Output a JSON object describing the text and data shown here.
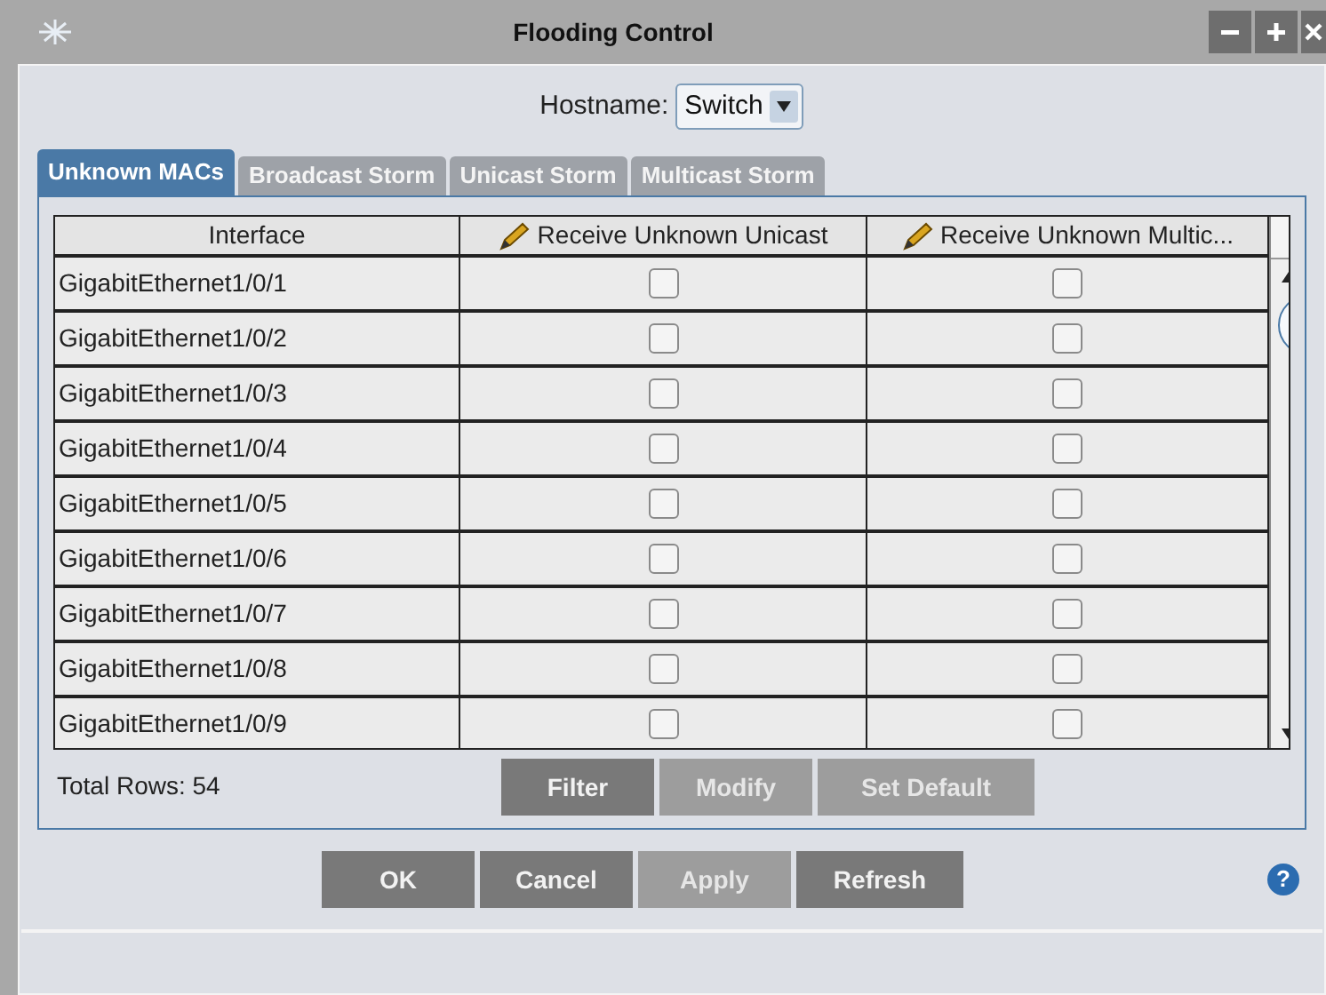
{
  "window": {
    "title": "Flooding Control"
  },
  "hostname": {
    "label": "Hostname:",
    "value": "Switch"
  },
  "tabs": [
    {
      "label": "Unknown MACs",
      "selected": true
    },
    {
      "label": "Broadcast Storm",
      "selected": false
    },
    {
      "label": "Unicast Storm",
      "selected": false
    },
    {
      "label": "Multicast Storm",
      "selected": false
    }
  ],
  "table": {
    "columns": [
      {
        "label": "Interface",
        "editable": false
      },
      {
        "label": "Receive Unknown Unicast",
        "editable": true
      },
      {
        "label": "Receive Unknown Multic...",
        "editable": true
      }
    ],
    "rows": [
      {
        "interface": "GigabitEthernet1/0/1",
        "unicast": false,
        "multicast": false
      },
      {
        "interface": "GigabitEthernet1/0/2",
        "unicast": false,
        "multicast": false
      },
      {
        "interface": "GigabitEthernet1/0/3",
        "unicast": false,
        "multicast": false
      },
      {
        "interface": "GigabitEthernet1/0/4",
        "unicast": false,
        "multicast": false
      },
      {
        "interface": "GigabitEthernet1/0/5",
        "unicast": false,
        "multicast": false
      },
      {
        "interface": "GigabitEthernet1/0/6",
        "unicast": false,
        "multicast": false
      },
      {
        "interface": "GigabitEthernet1/0/7",
        "unicast": false,
        "multicast": false
      },
      {
        "interface": "GigabitEthernet1/0/8",
        "unicast": false,
        "multicast": false
      },
      {
        "interface": "GigabitEthernet1/0/9",
        "unicast": false,
        "multicast": false
      }
    ]
  },
  "total_rows": "Total Rows: 54",
  "help": "?",
  "table_buttons": [
    {
      "label": "Filter",
      "disabled": false
    },
    {
      "label": "Modify",
      "disabled": true
    },
    {
      "label": "Set Default",
      "disabled": true
    }
  ],
  "dialog_buttons": [
    {
      "label": "OK",
      "disabled": false
    },
    {
      "label": "Cancel",
      "disabled": false
    },
    {
      "label": "Apply",
      "disabled": true
    },
    {
      "label": "Refresh",
      "disabled": false
    }
  ]
}
